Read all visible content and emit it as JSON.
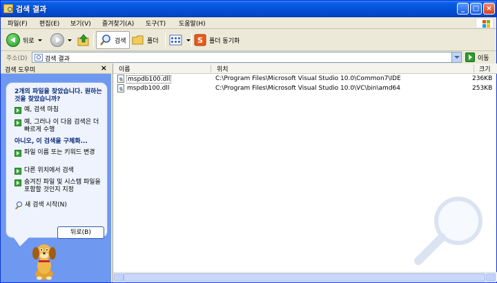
{
  "window": {
    "title": "검색 결과"
  },
  "menu": [
    "파일(F)",
    "편집(E)",
    "보기(V)",
    "즐겨찾기(A)",
    "도구(T)",
    "도움말(H)"
  ],
  "toolbar": {
    "back_label": "뒤로",
    "search_label": "검색",
    "folders_label": "폴더",
    "sync_label": "폴더 동기화"
  },
  "address": {
    "label": "주소(D)",
    "value": "검색 결과",
    "go_label": "이동"
  },
  "search_pane": {
    "title": "검색 도우미",
    "headline": "2개의 파일을 찾았습니다. 원하는 것을 찾았습니까?",
    "options_yes": [
      "예, 검색 마침",
      "예, 그러나 이 다음 검색은 더 빠르게 수행"
    ],
    "refine_headline": "아니오, 이 검색을 구체화...",
    "options_refine": [
      "파일 이름 또는 키워드 변경",
      "다른 위치에서 검색",
      "숨겨진 파일 및 시스템 파일을 포함할 것인지 지정"
    ],
    "new_search_label": "새 검색 시작(N)",
    "back_button_label": "뒤로(B)"
  },
  "file_list": {
    "columns": [
      "이름",
      "위치",
      "크기"
    ],
    "rows": [
      {
        "name": "mspdb100.dll",
        "location": "C:\\Program Files\\Microsoft Visual Studio 10.0\\Common7\\IDE",
        "size": "236KB"
      },
      {
        "name": "mspdb100.dll",
        "location": "C:\\Program Files\\Microsoft Visual Studio 10.0\\VC\\bin\\amd64",
        "size": "253KB"
      }
    ]
  },
  "colors": {
    "title_bar": "#0552d8",
    "pane_bg": "#6f98f0",
    "accent_green": "#3aa53a"
  }
}
